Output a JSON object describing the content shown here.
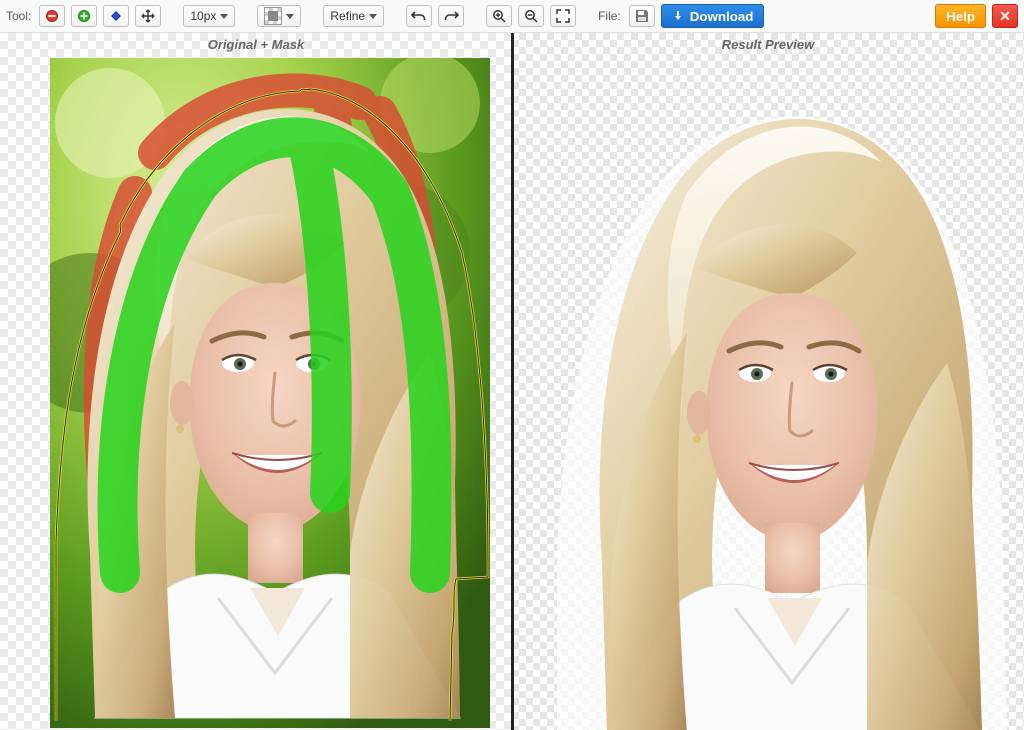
{
  "toolbar": {
    "tool_label": "Tool:",
    "brush_size": "10px",
    "refine_label": "Refine",
    "file_label": "File:",
    "download_label": "Download",
    "help_label": "Help",
    "close_glyph": "✕",
    "icons": {
      "erase": "minus-circle-icon",
      "keep": "plus-circle-icon",
      "hair": "diamond-icon",
      "move": "move-icon",
      "bgcolor": "bg-color-swatch",
      "undo": "undo-icon",
      "redo": "redo-icon",
      "zoom_in": "zoom-in-icon",
      "zoom_out": "zoom-out-icon",
      "fit": "fit-screen-icon",
      "save": "save-disk-icon",
      "download_arrow": "download-arrow-icon"
    }
  },
  "panels": {
    "left_title": "Original + Mask",
    "right_title": "Result Preview"
  }
}
